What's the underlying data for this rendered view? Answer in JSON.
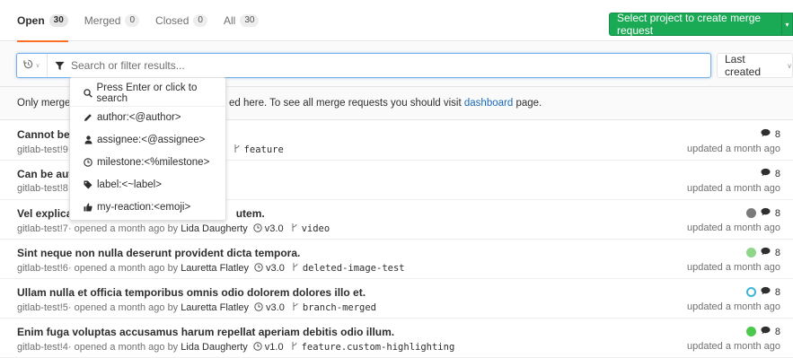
{
  "tabs": [
    {
      "label": "Open",
      "count": "30"
    },
    {
      "label": "Merged",
      "count": "0"
    },
    {
      "label": "Closed",
      "count": "0"
    },
    {
      "label": "All",
      "count": "30"
    }
  ],
  "create_button": {
    "label": "Select project to create merge request"
  },
  "filter": {
    "placeholder": "Search or filter results...",
    "sort_label": "Last created"
  },
  "info": {
    "prefix": "Only merge r",
    "suffix": "ed here. To see all merge requests you should visit ",
    "link": "dashboard",
    "tail": " page."
  },
  "dropdown": {
    "hint": "Press Enter or click to search",
    "items": [
      {
        "label": "author:<@author>",
        "icon": "pencil-icon"
      },
      {
        "label": "assignee:<@assignee>",
        "icon": "user-icon"
      },
      {
        "label": "milestone:<%milestone>",
        "icon": "clock-icon"
      },
      {
        "label": "label:<~label>",
        "icon": "tag-icon"
      },
      {
        "label": "my-reaction:<emoji>",
        "icon": "thumbs-up-icon"
      }
    ]
  },
  "merge_requests": [
    {
      "title": "Cannot be a",
      "ref": "gitlab-test!9",
      "meta_tail": "r",
      "author": "",
      "milestone": "",
      "branch": "feature",
      "comments": "8",
      "updated": "updated a month ago",
      "pipeline_color": ""
    },
    {
      "title": "Can be auto",
      "ref": "gitlab-test!8",
      "meta_tail": "r",
      "author": "",
      "milestone": "",
      "branch": "",
      "comments": "8",
      "updated": "updated a month ago",
      "pipeline_color": ""
    },
    {
      "title": "Vel explicab",
      "title_tail": "utem.",
      "ref": "gitlab-test!7",
      "meta_tail": " · opened a month ago by",
      "author": "Lida Daugherty",
      "milestone": "v3.0",
      "branch": "video",
      "comments": "8",
      "updated": "updated a month ago",
      "pipeline_color": "#7a7a7a"
    },
    {
      "title": "Sint neque non nulla deserunt provident dicta tempora.",
      "ref": "gitlab-test!6",
      "meta_tail": " · opened a month ago by",
      "author": "Lauretta Flatley",
      "milestone": "v3.0",
      "branch": "deleted-image-test",
      "comments": "8",
      "updated": "updated a month ago",
      "pipeline_color": "#8fd68a"
    },
    {
      "title": "Ullam nulla et officia temporibus omnis odio dolorem dolores illo et.",
      "ref": "gitlab-test!5",
      "meta_tail": " · opened a month ago by",
      "author": "Lauretta Flatley",
      "milestone": "v3.0",
      "branch": "branch-merged",
      "comments": "8",
      "updated": "updated a month ago",
      "pipeline_color": "#3bb4d8"
    },
    {
      "title": "Enim fuga voluptas accusamus harum repellat aperiam debitis odio illum.",
      "ref": "gitlab-test!4",
      "meta_tail": " · opened a month ago by",
      "author": "Lida Daugherty",
      "milestone": "v1.0",
      "branch": "feature.custom-highlighting",
      "comments": "8",
      "updated": "updated a month ago",
      "pipeline_color": "#4cc94c"
    }
  ],
  "colors": {
    "accent": "#fc6d26",
    "success": "#1aaa55",
    "link": "#1b69b6",
    "focus": "#73afea"
  }
}
